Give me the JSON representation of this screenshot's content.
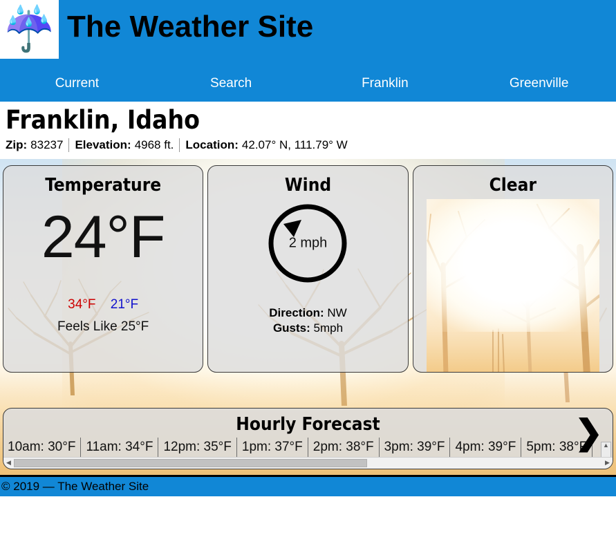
{
  "header": {
    "logo_icon": "umbrella-with-rain-drops-icon",
    "logo_glyph": "☔",
    "title": "The Weather Site",
    "brand_color": "#1187d6"
  },
  "nav": {
    "items": [
      {
        "label": "Current"
      },
      {
        "label": "Search"
      },
      {
        "label": "Franklin"
      },
      {
        "label": "Greenville"
      }
    ]
  },
  "location": {
    "title": "Franklin, Idaho",
    "meta": [
      {
        "label": "Zip:",
        "value": "83237"
      },
      {
        "label": "Elevation:",
        "value": "4968 ft."
      },
      {
        "label": "Location:",
        "value": "42.07° N, 111.79° W"
      }
    ]
  },
  "temperature_card": {
    "title": "Temperature",
    "current": "24°F",
    "high": "34°F",
    "low": "21°F",
    "feels_like": "Feels Like 25°F",
    "high_color": "#cc0000",
    "low_color": "#1111cc"
  },
  "wind_card": {
    "title": "Wind",
    "speed": "2 mph",
    "direction_label": "Direction:",
    "direction_value": "NW",
    "gusts_label": "Gusts:",
    "gusts_value": "5mph",
    "dial_icon": "wind-direction-dial-icon"
  },
  "condition_card": {
    "title": "Clear",
    "photo_icon": "sunlit-trees-photo"
  },
  "hourly": {
    "title": "Hourly Forecast",
    "next_icon": "chevron-right-icon",
    "next_glyph": "❯",
    "hours": [
      {
        "label": "10am: 30°F"
      },
      {
        "label": "11am: 34°F"
      },
      {
        "label": "12pm: 35°F"
      },
      {
        "label": "1pm: 37°F"
      },
      {
        "label": "2pm: 38°F"
      },
      {
        "label": "3pm: 39°F"
      },
      {
        "label": "4pm: 39°F"
      },
      {
        "label": "5pm: 38°F"
      }
    ],
    "scroll_left_glyph": "◀",
    "scroll_right_glyph": "▶",
    "scroll_up_glyph": "▲",
    "scroll_down_glyph": "▼"
  },
  "footer": {
    "text": "© 2019 — The Weather Site"
  }
}
